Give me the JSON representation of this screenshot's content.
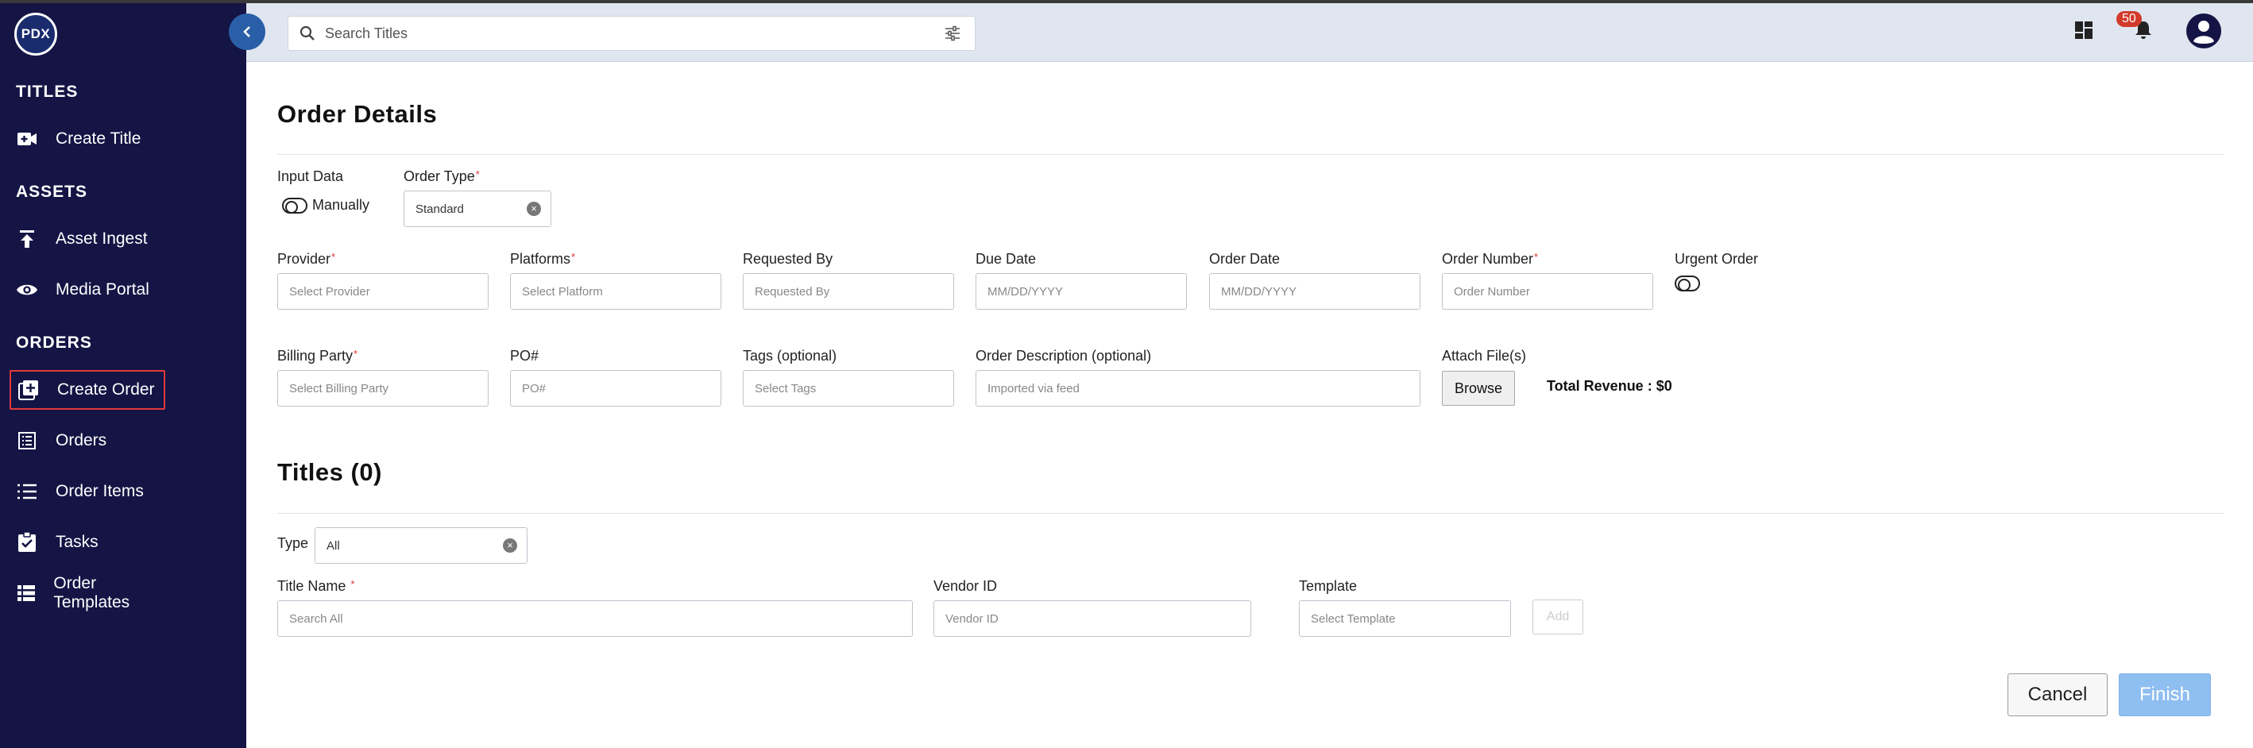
{
  "app": {
    "logo_text": "PDX"
  },
  "sidebar": {
    "sections": [
      {
        "title": "TITLES",
        "items": [
          {
            "label": "Create Title",
            "icon": "video-plus-icon"
          }
        ]
      },
      {
        "title": "ASSETS",
        "items": [
          {
            "label": "Asset Ingest",
            "icon": "upload-icon"
          },
          {
            "label": "Media Portal",
            "icon": "eye-icon"
          }
        ]
      },
      {
        "title": "ORDERS",
        "items": [
          {
            "label": "Create Order",
            "icon": "add-box-icon",
            "active": true
          },
          {
            "label": "Orders",
            "icon": "receipt-icon"
          },
          {
            "label": "Order Items",
            "icon": "list-icon"
          },
          {
            "label": "Tasks",
            "icon": "clipboard-check-icon"
          },
          {
            "label": "Order Templates",
            "icon": "view-list-icon"
          }
        ]
      }
    ]
  },
  "topbar": {
    "search_placeholder": "Search Titles",
    "notification_count": "50"
  },
  "order_details": {
    "heading": "Order Details",
    "input_data_label": "Input Data",
    "manually_label": "Manually",
    "order_type_label": "Order Type",
    "order_type_value": "Standard",
    "provider_label": "Provider",
    "provider_placeholder": "Select Provider",
    "platforms_label": "Platforms",
    "platforms_placeholder": "Select Platform",
    "requested_by_label": "Requested By",
    "requested_by_placeholder": "Requested By",
    "due_date_label": "Due Date",
    "due_date_placeholder": "MM/DD/YYYY",
    "order_date_label": "Order Date",
    "order_date_placeholder": "MM/DD/YYYY",
    "order_number_label": "Order Number",
    "order_number_placeholder": "Order Number",
    "urgent_label": "Urgent Order",
    "billing_party_label": "Billing Party",
    "billing_party_placeholder": "Select Billing Party",
    "po_label": "PO#",
    "po_placeholder": "PO#",
    "tags_label": "Tags (optional)",
    "tags_placeholder": "Select Tags",
    "description_label": "Order Description (optional)",
    "description_placeholder": "Imported via feed",
    "attach_label": "Attach File(s)",
    "browse_label": "Browse",
    "total_revenue": "Total Revenue : $0"
  },
  "titles": {
    "heading": "Titles (0)",
    "type_label": "Type",
    "type_value": "All",
    "title_name_label": "Title Name",
    "title_name_placeholder": "Search All",
    "vendor_id_label": "Vendor ID",
    "vendor_id_placeholder": "Vendor ID",
    "template_label": "Template",
    "template_placeholder": "Select Template",
    "add_label": "Add"
  },
  "footer": {
    "cancel_label": "Cancel",
    "finish_label": "Finish"
  },
  "colors": {
    "sidebar_bg": "#141445",
    "accent": "#2a5fa8",
    "finish_disabled": "#8fbef0",
    "active_outline": "#e33a3a"
  }
}
